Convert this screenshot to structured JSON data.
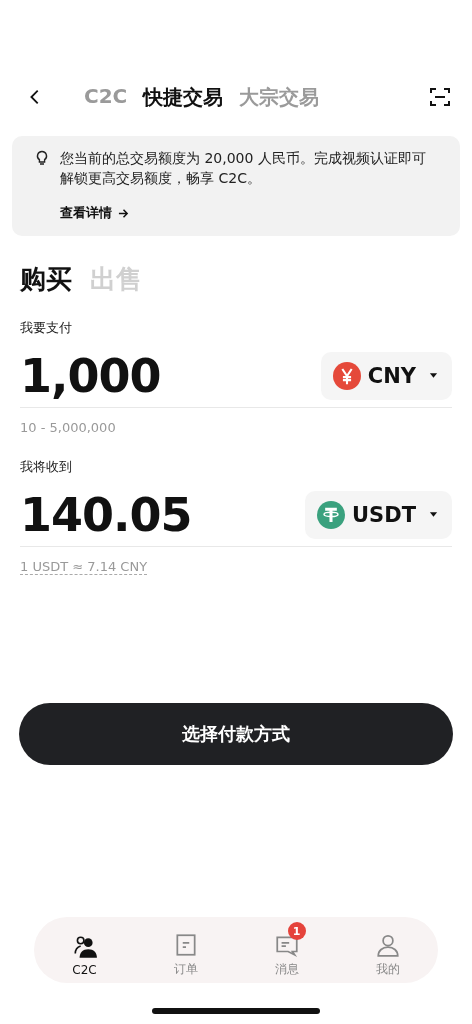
{
  "top_tabs": [
    {
      "label": "C2C",
      "selected": false
    },
    {
      "label": "快捷交易",
      "selected": true
    },
    {
      "label": "大宗交易",
      "selected": false
    }
  ],
  "notice": {
    "text": "您当前的总交易额度为 20,000 人民币。完成视频认证即可解锁更高交易额度，畅享 C2C。",
    "link": "查看详情"
  },
  "trade_tabs": [
    {
      "label": "购买",
      "selected": true
    },
    {
      "label": "出售",
      "selected": false
    }
  ],
  "fields": [
    {
      "label": "我要支付",
      "amount": "1,000",
      "currency": "CNY",
      "kind": "cny",
      "hint": "10 - 5,000,000",
      "hint_dashed": false
    },
    {
      "label": "我将收到",
      "amount": "140.05",
      "currency": "USDT",
      "kind": "usdt",
      "hint": "1 USDT ≈ 7.14 CNY",
      "hint_dashed": true
    }
  ],
  "primary_button": "选择付款方式",
  "bottom_nav": [
    {
      "label": "C2C",
      "kind": "people",
      "selected": true
    },
    {
      "label": "订单",
      "kind": "doc",
      "selected": false
    },
    {
      "label": "消息",
      "kind": "chat",
      "selected": false,
      "badge": "1"
    },
    {
      "label": "我的",
      "kind": "person",
      "selected": false
    }
  ]
}
